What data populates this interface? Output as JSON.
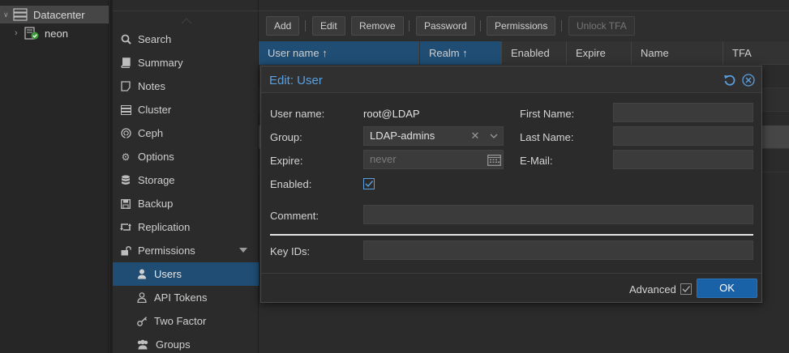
{
  "tree": {
    "datacenter_label": "Datacenter",
    "node_label": "neon"
  },
  "nav": {
    "items": [
      {
        "label": "Search",
        "icon": "search-icon"
      },
      {
        "label": "Summary",
        "icon": "book-icon"
      },
      {
        "label": "Notes",
        "icon": "notes-icon"
      },
      {
        "label": "Cluster",
        "icon": "server-icon"
      },
      {
        "label": "Ceph",
        "icon": "ceph-icon"
      },
      {
        "label": "Options",
        "icon": "gear-icon"
      },
      {
        "label": "Storage",
        "icon": "database-icon"
      },
      {
        "label": "Backup",
        "icon": "floppy-icon"
      },
      {
        "label": "Replication",
        "icon": "retweet-icon"
      },
      {
        "label": "Permissions",
        "icon": "unlock-icon"
      },
      {
        "label": "Users",
        "icon": "user-icon"
      },
      {
        "label": "API Tokens",
        "icon": "user-outline-icon"
      },
      {
        "label": "Two Factor",
        "icon": "key-icon"
      },
      {
        "label": "Groups",
        "icon": "users-icon"
      }
    ],
    "active": "Users"
  },
  "toolbar": {
    "add": "Add",
    "edit": "Edit",
    "remove": "Remove",
    "password": "Password",
    "permissions": "Permissions",
    "unlock_tfa": "Unlock TFA"
  },
  "grid": {
    "columns": [
      "User name ↑",
      "Realm ↑",
      "Enabled",
      "Expire",
      "Name",
      "TFA"
    ]
  },
  "dialog": {
    "title": "Edit: User",
    "username_label": "User name:",
    "username_value": "root@LDAP",
    "group_label": "Group:",
    "group_value": "LDAP-admins",
    "expire_label": "Expire:",
    "expire_placeholder": "never",
    "enabled_label": "Enabled:",
    "enabled_checked": true,
    "firstname_label": "First Name:",
    "lastname_label": "Last Name:",
    "email_label": "E-Mail:",
    "comment_label": "Comment:",
    "keyids_label": "Key IDs:",
    "advanced_label": "Advanced",
    "advanced_checked": true,
    "ok_label": "OK"
  },
  "colors": {
    "accent": "#5aa0e0",
    "selection": "#1f4d74",
    "primary_button": "#1a62a8"
  }
}
